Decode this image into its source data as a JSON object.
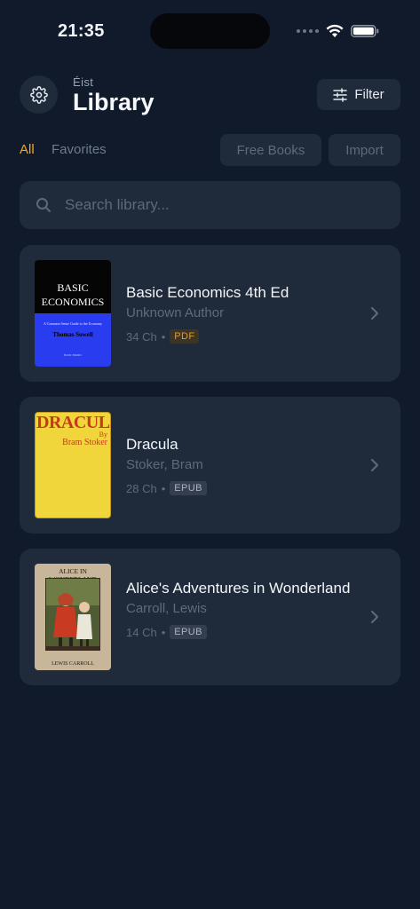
{
  "status_bar": {
    "time": "21:35"
  },
  "header": {
    "subtitle": "Éist",
    "title": "Library",
    "filter_label": "Filter"
  },
  "tabs": {
    "all_label": "All",
    "favorites_label": "Favorites"
  },
  "actions": {
    "free_books_label": "Free Books",
    "import_label": "Import"
  },
  "search": {
    "placeholder": "Search library..."
  },
  "books": [
    {
      "title": "Basic Economics 4th Ed",
      "author": "Unknown Author",
      "chapters": "34 Ch",
      "separator": "•",
      "format": "PDF",
      "cover": {
        "line1": "BASIC",
        "line2": "ECONOMICS",
        "tagline": "A Common Sense Guide to the Economy",
        "author": "Thomas Sowell",
        "publisher": "BASIC BOOKS"
      }
    },
    {
      "title": "Dracula",
      "author": "Stoker, Bram",
      "chapters": "28 Ch",
      "separator": "•",
      "format": "EPUB",
      "cover": {
        "title": "DRACULA",
        "by": "By",
        "author": "Bram Stoker"
      }
    },
    {
      "title": "Alice's Adventures in Wonderland",
      "author": "Carroll, Lewis",
      "chapters": "14 Ch",
      "separator": "•",
      "format": "EPUB",
      "cover": {
        "title": "ALICE IN WONDERLAND",
        "author": "LEWIS CARROLL"
      }
    }
  ],
  "colors": {
    "background": "#111a2b",
    "surface": "#1f2a3b",
    "accent": "#f5a623",
    "pdf_badge": "#e29b2b",
    "muted_text": "#5f6a7c"
  },
  "icons": [
    "gear-icon",
    "sliders-icon",
    "search-icon",
    "chevron-right-icon",
    "wifi-icon",
    "battery-icon",
    "signal-icon"
  ]
}
